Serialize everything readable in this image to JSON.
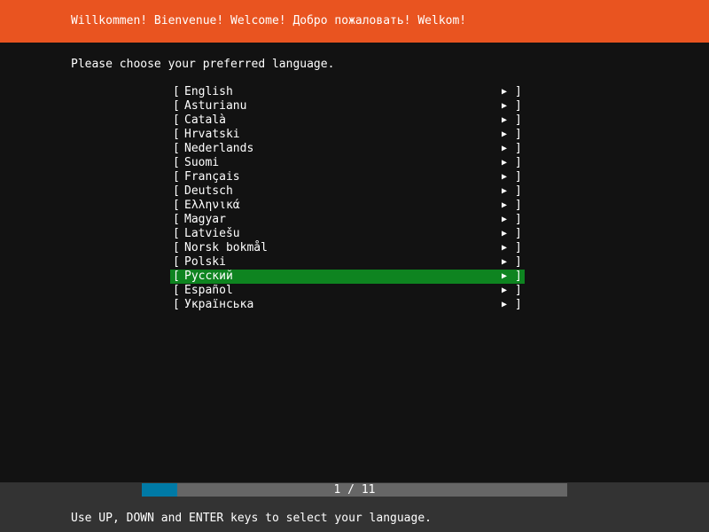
{
  "header": {
    "title": "Willkommen! Bienvenue! Welcome! Добро пожаловать! Welkom!"
  },
  "prompt": "Please choose your preferred language.",
  "menu": {
    "left_bracket": "[",
    "right_bracket": "]",
    "arrow": "▶",
    "selected_index": 13,
    "items": [
      {
        "label": "English"
      },
      {
        "label": "Asturianu"
      },
      {
        "label": "Català"
      },
      {
        "label": "Hrvatski"
      },
      {
        "label": "Nederlands"
      },
      {
        "label": "Suomi"
      },
      {
        "label": "Français"
      },
      {
        "label": "Deutsch"
      },
      {
        "label": "Ελληνικά"
      },
      {
        "label": "Magyar"
      },
      {
        "label": "Latviešu"
      },
      {
        "label": "Norsk bokmål"
      },
      {
        "label": "Polski"
      },
      {
        "label": "Русский"
      },
      {
        "label": "Español"
      },
      {
        "label": "Українська"
      }
    ]
  },
  "progress": {
    "label": "1 / 11",
    "fraction": 0.083
  },
  "status": "Use UP, DOWN and ENTER keys to select your language.",
  "colors": {
    "header_bg": "#e95420",
    "background": "#121212",
    "selected_bg": "#0e8420",
    "progress_fill": "#007aa6",
    "progress_track": "#666666",
    "footer_bg": "#333333"
  }
}
